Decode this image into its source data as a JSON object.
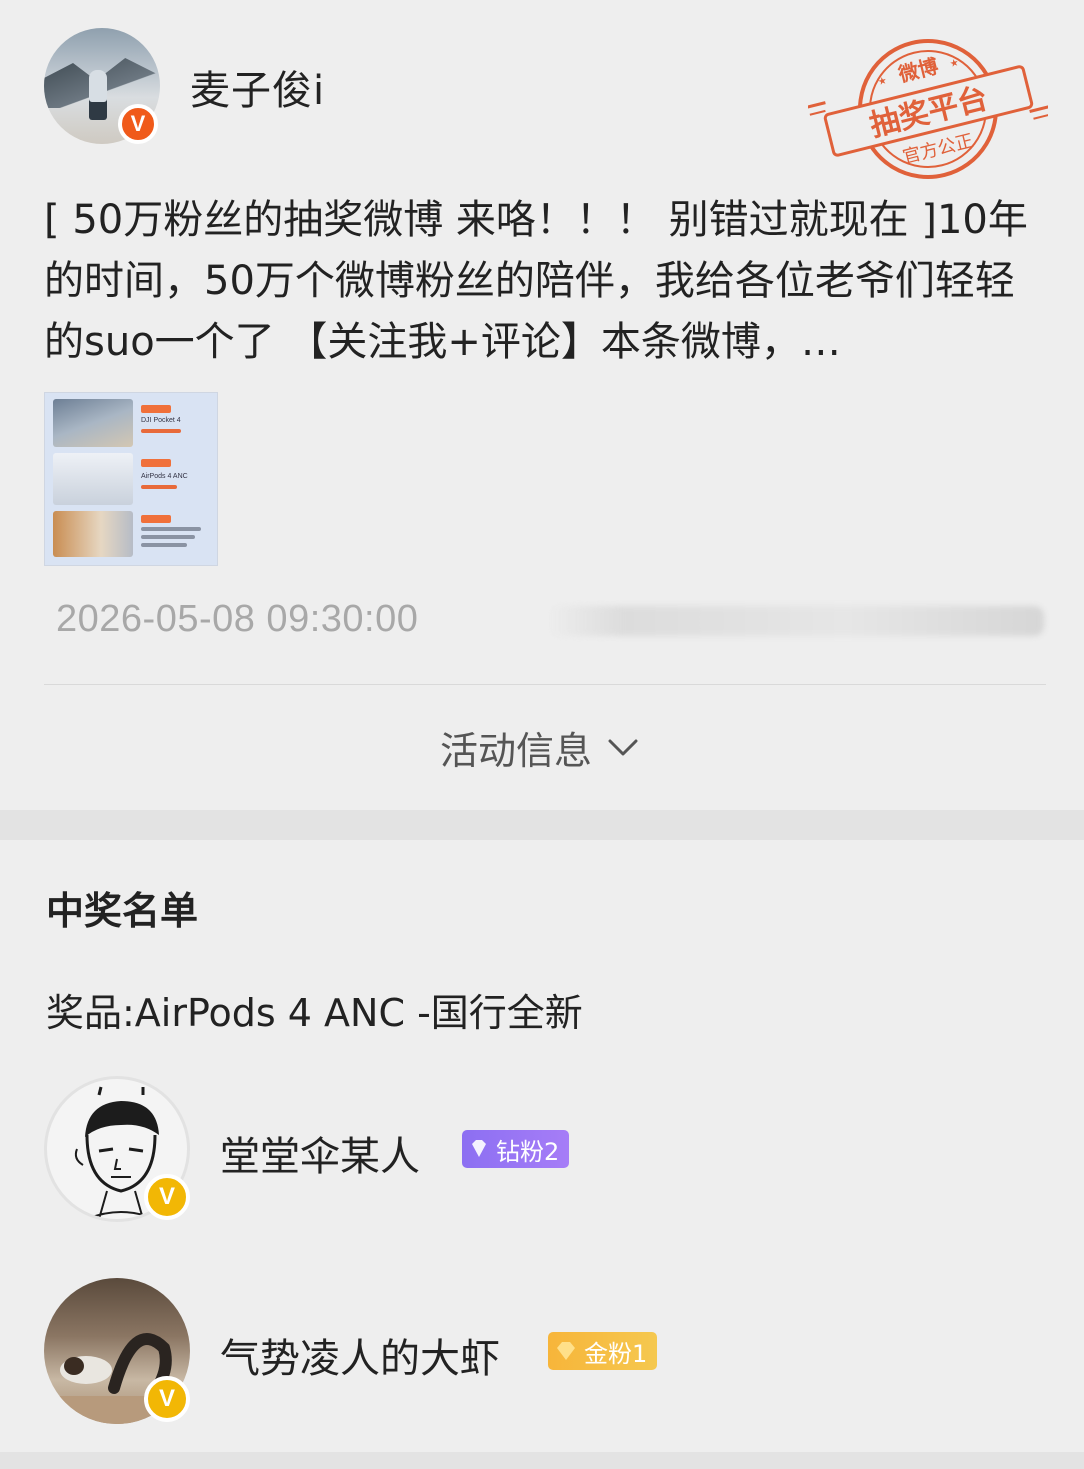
{
  "post": {
    "username": "麦子俊i",
    "text": "[ 50万粉丝的抽奖微博 来咯！！！ 别错过就现在 ]10年的时间，50万个微博粉丝的陪伴，我给各位老爷们轻轻的suo一个了 【关注我+评论】本条微博，…",
    "timestamp": "2026-05-08 09:30:00",
    "activity_toggle_label": "活动信息",
    "stamp": {
      "top": "微博",
      "middle": "抽奖平台",
      "bottom": "官方公正"
    },
    "thumbnail_texts": [
      "DJI Pocket 4",
      "AirPods 4 ANC"
    ]
  },
  "winners": {
    "title": "中奖名单",
    "prize": "奖品:AirPods 4 ANC -国行全新",
    "items": [
      {
        "name": "堂堂伞某人",
        "badge": "钻粉2"
      },
      {
        "name": "气势凌人的大虾",
        "badge": "金粉1"
      }
    ]
  },
  "colors": {
    "verified_red": "#f05a1a",
    "verified_gold": "#f2b705",
    "stamp_red": "#e0613a",
    "badge_diamond": "#9a76f5",
    "badge_gold": "#f6bd43",
    "timestamp_gray": "#a8a8a8"
  }
}
